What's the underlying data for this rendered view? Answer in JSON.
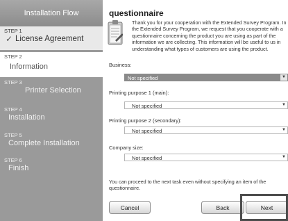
{
  "sidebar": {
    "title": "Installation Flow",
    "steps": [
      {
        "num": "STEP 1",
        "label": "License Agreement",
        "check": "✓"
      },
      {
        "num": "STEP 2",
        "label": "Information"
      },
      {
        "num": "STEP 3",
        "label": "Printer Selection"
      },
      {
        "num": "STEP 4",
        "label": "Installation"
      },
      {
        "num": "STEP 5",
        "label": "Complete Installation"
      },
      {
        "num": "STEP 6",
        "label": "Finish"
      }
    ]
  },
  "main": {
    "title": "questionnaire",
    "description": "Thank you for your cooperation with the Extended Survey Program. In the Extended Survey Program, we request that you cooperate with a questionnaire concerning the product you are using as part of the information we are collecting. This information will be useful to us in understanding what types of customers are using the product.",
    "fields": [
      {
        "label": "Business:",
        "value": "Not specified"
      },
      {
        "label": "Printing purpose 1 (main):",
        "value": "Not specified"
      },
      {
        "label": "Printing purpose 2 (secondary):",
        "value": "Not specified"
      },
      {
        "label": "Company size:",
        "value": "Not specified"
      }
    ],
    "footnote": "You can proceed to the next task even without specifying an item of the questionnaire."
  },
  "buttons": {
    "cancel": "Cancel",
    "back": "Back",
    "next": "Next"
  },
  "colors": {
    "sidebar_bg": "#9a9a9a",
    "active_step_bg": "#ffffff",
    "done_step_bg": "#e9e9e9",
    "selected_field_bg": "#8a8a8a"
  }
}
